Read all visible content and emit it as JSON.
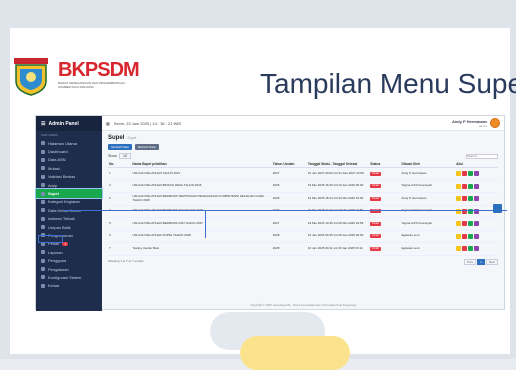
{
  "slide": {
    "title": "Tampilan Menu Supel",
    "logo_text_main": "BKPSDM",
    "logo_text_sub": "BADAN KEPEGAWAIAN DAN PENGEMBANGAN SUMBER DAYA MANUSIA"
  },
  "app": {
    "brand": "Admin Panel",
    "topbar_date": "Senin, 23 Juni 2025 | 14 : 36 : 21 WIB",
    "user_name": "Andy P Hermawan",
    "user_role": "admin",
    "sidebar_section": "MAIN MENU",
    "sidebar": [
      {
        "label": "Halaman Utama"
      },
      {
        "label": "Dashboard"
      },
      {
        "label": "Data ASN"
      },
      {
        "label": "Mutasi"
      },
      {
        "label": "Validasi Berkas"
      },
      {
        "label": "Arsip"
      },
      {
        "label": "Supel",
        "active": true
      },
      {
        "label": "Kategori Kegiatan"
      },
      {
        "label": "Data Ketua Umum"
      },
      {
        "label": "Instansi Terkait"
      },
      {
        "label": "Umpan Balik"
      },
      {
        "label": "Pengumuman"
      },
      {
        "label": "Pesan",
        "badge": "1"
      },
      {
        "label": "Laporan"
      },
      {
        "label": "Pengguna"
      },
      {
        "label": "Pengaturan"
      },
      {
        "label": "Konfigurasi Sistem"
      },
      {
        "label": "Keluar"
      }
    ],
    "page_title": "Supel",
    "breadcrumb": "Supel",
    "btn_add": "Tambah Data",
    "btn_refresh": "Refresh Data",
    "show_label": "Show",
    "show_value": "10",
    "search_placeholder": "Search...",
    "columns": [
      "No.",
      "Nama Bapel pelatihan",
      "Tahun Usulan",
      "Tanggal Mulai - Tanggal Selesai",
      "Status",
      "Dibuat Oleh",
      "Aksi"
    ],
    "rows": [
      {
        "no": "1",
        "name": "USULAN PELATIHAN TAHUN 2027",
        "year": "2027",
        "dates": "01 Jan 2027 00:00 s/d 31 Des 2027 23:59",
        "status": "Draft",
        "by": "Andy P Hermawan"
      },
      {
        "no": "2",
        "name": "USULAN PELATIHAN BIDANG DESA TAHUN 2026",
        "year": "2026",
        "dates": "19 Mei 2025 16:45 s/d 20 Jan 2026 00:00",
        "status": "Draft",
        "by": "Tegina Arif Firmansyah"
      },
      {
        "no": "3",
        "name": "USULAN PELATIHAN BERBASIS SERTIFIKASI PENGUASAAN KOMPETENSI KEAHLIAN GURU TAHUN 2025",
        "year": "2025",
        "dates": "19 Mei 2025 15:23 s/d 30 Mei 2025 16:00",
        "status": "Draft",
        "by": "Andy P Hermawan"
      },
      {
        "no": "4",
        "name": "USULAN PELATIHAN BERBASIS ASN TAHUN 2026",
        "year": "2026",
        "dates": "19 Mei 2025 11:33 s/d 19 Mei 2025 19:59",
        "status": "Draft",
        "by": "Tegina Arif Firmansyah"
      },
      {
        "no": "5",
        "name": "USULAN PELATIHAN BERBASIS ASN TAHUN 2027",
        "year": "2027",
        "dates": "19 Mei 2025 10:46 s/d 28 Mei 2025 19:59",
        "status": "Draft",
        "by": "Tegina Arif Firmansyah"
      },
      {
        "no": "6",
        "name": "USULAN PELATIHAN SUPEL TAHUN 2028",
        "year": "2028",
        "dates": "16 Jan 2025 09:45 s/d 28 Jan 2025 09:00",
        "status": "Draft",
        "by": "Egiawan sent"
      },
      {
        "no": "7",
        "name": "Testing Usulan Bola",
        "year": "2028",
        "dates": "16 Jan 2025 09:11 s/d 30 Jan 2025 09:11",
        "status": "Draft",
        "by": "Egiawan sent"
      }
    ],
    "showing": "Showing 1 to 7 of 7 entries",
    "pagination": [
      "Prev",
      "1",
      "Next"
    ],
    "copyright": "Copyright © 2025. Developed By : Dinas Komunikasi dan Informatika Kota Tangerang",
    "colors": {
      "sidebar": "#1f2d4d",
      "active": "#1aa84e",
      "status": "#e53946",
      "primary": "#2d6fbf"
    }
  }
}
